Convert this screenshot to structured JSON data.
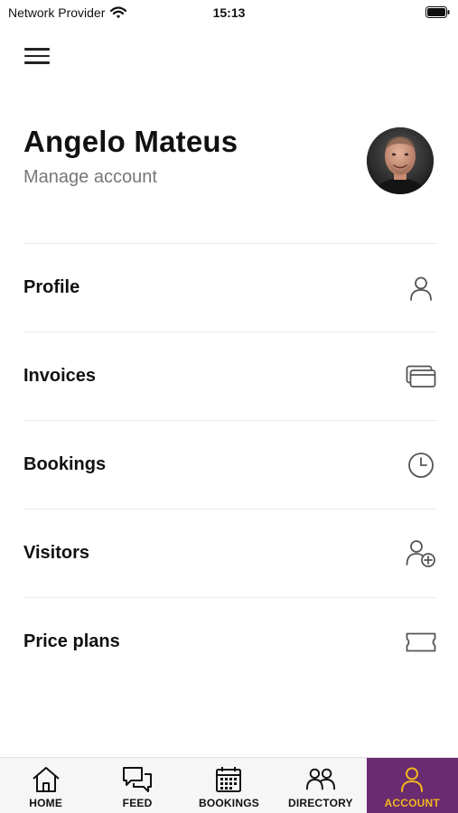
{
  "status_bar": {
    "carrier": "Network Provider",
    "time": "15:13",
    "wifi_icon": "wifi-icon",
    "battery_icon": "battery-icon"
  },
  "header": {
    "menu_icon": "hamburger-menu-icon"
  },
  "account": {
    "name": "Angelo Mateus",
    "manage_label": "Manage account",
    "avatar": "avatar-photo"
  },
  "menu": {
    "items": [
      {
        "label": "Profile",
        "icon": "person-icon"
      },
      {
        "label": "Invoices",
        "icon": "cards-icon"
      },
      {
        "label": "Bookings",
        "icon": "clock-icon"
      },
      {
        "label": "Visitors",
        "icon": "add-person-icon"
      },
      {
        "label": "Price plans",
        "icon": "ticket-icon"
      }
    ]
  },
  "tab_bar": {
    "active_index": 4,
    "active_background": "#6a2b70",
    "active_color": "#f1b51f",
    "tabs": [
      {
        "label": "HOME",
        "icon": "home-icon"
      },
      {
        "label": "FEED",
        "icon": "chat-bubbles-icon"
      },
      {
        "label": "BOOKINGS",
        "icon": "calendar-icon"
      },
      {
        "label": "DIRECTORY",
        "icon": "people-icon"
      },
      {
        "label": "ACCOUNT",
        "icon": "person-icon"
      }
    ]
  }
}
